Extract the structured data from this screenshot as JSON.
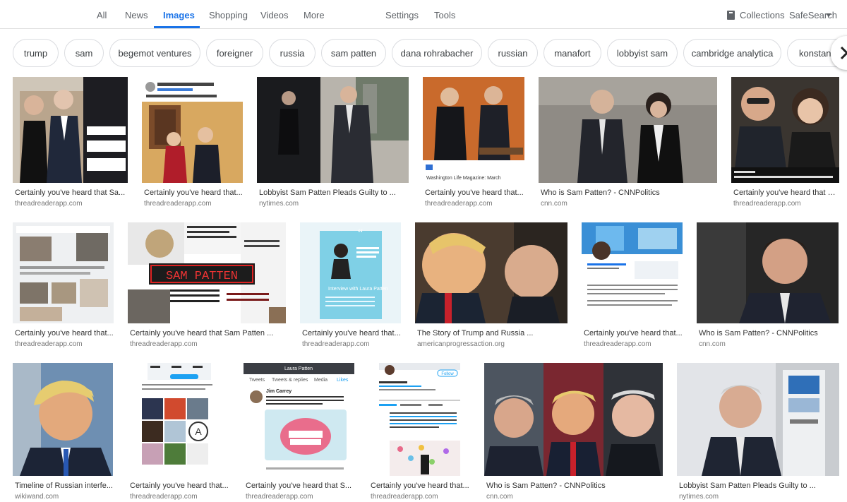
{
  "nav": {
    "tabs": [
      "All",
      "News",
      "Images",
      "Shopping",
      "Videos",
      "More"
    ],
    "settings": "Settings",
    "tools": "Tools",
    "collections": "Collections",
    "safesearch": "SafeSearch"
  },
  "chips": [
    "trump",
    "sam",
    "begemot ventures",
    "foreigner",
    "russia",
    "sam patten",
    "dana rohrabacher",
    "russian",
    "manafort",
    "lobbyist sam",
    "cambridge analytica",
    "konstanti"
  ],
  "results": [
    {
      "title": "Certainly you've heard that Sa...",
      "source": "threadreaderapp.com"
    },
    {
      "title": "Certainly you've heard that...",
      "source": "threadreaderapp.com"
    },
    {
      "title": "Lobbyist Sam Patten Pleads Guilty to ...",
      "source": "nytimes.com"
    },
    {
      "title": "Certainly you've heard that...",
      "source": "threadreaderapp.com"
    },
    {
      "title": "Who is Sam Patten? - CNNPolitics",
      "source": "cnn.com"
    },
    {
      "title": "Certainly you've heard that S...",
      "source": "threadreaderapp.com"
    },
    {
      "title": "Certainly you've heard that...",
      "source": "threadreaderapp.com"
    },
    {
      "title": "Certainly you've heard that Sam Patten ...",
      "source": "threadreaderapp.com"
    },
    {
      "title": "Certainly you've heard that...",
      "source": "threadreaderapp.com"
    },
    {
      "title": "The Story of Trump and Russia ...",
      "source": "americanprogressaction.org"
    },
    {
      "title": "Certainly you've heard that...",
      "source": "threadreaderapp.com"
    },
    {
      "title": "Who is Sam Patten? - CNNPolitics",
      "source": "cnn.com"
    },
    {
      "title": "Timeline of Russian interfe...",
      "source": "wikiwand.com"
    },
    {
      "title": "Certainly you've heard that...",
      "source": "threadreaderapp.com"
    },
    {
      "title": "Certainly you've heard that S...",
      "source": "threadreaderapp.com"
    },
    {
      "title": "Certainly you've heard that...",
      "source": "threadreaderapp.com"
    },
    {
      "title": "Who is Sam Patten? - CNNPolitics",
      "source": "cnn.com"
    },
    {
      "title": "Lobbyist Sam Patten Pleads Guilty to ...",
      "source": "nytimes.com"
    }
  ],
  "thumb_texts": {
    "sam_patten_banner": "SAM PATTEN",
    "interview_heading": "Interview with Laura Patten",
    "laura_patten": "Laura Patten",
    "follow": "Follow",
    "tweets": "Tweets",
    "tweets_replies": "Tweets & replies",
    "media": "Media",
    "likes": "Likes",
    "jim_carrey": "Jim Carrey",
    "washington_life": "Washington Life Magazine: March"
  }
}
